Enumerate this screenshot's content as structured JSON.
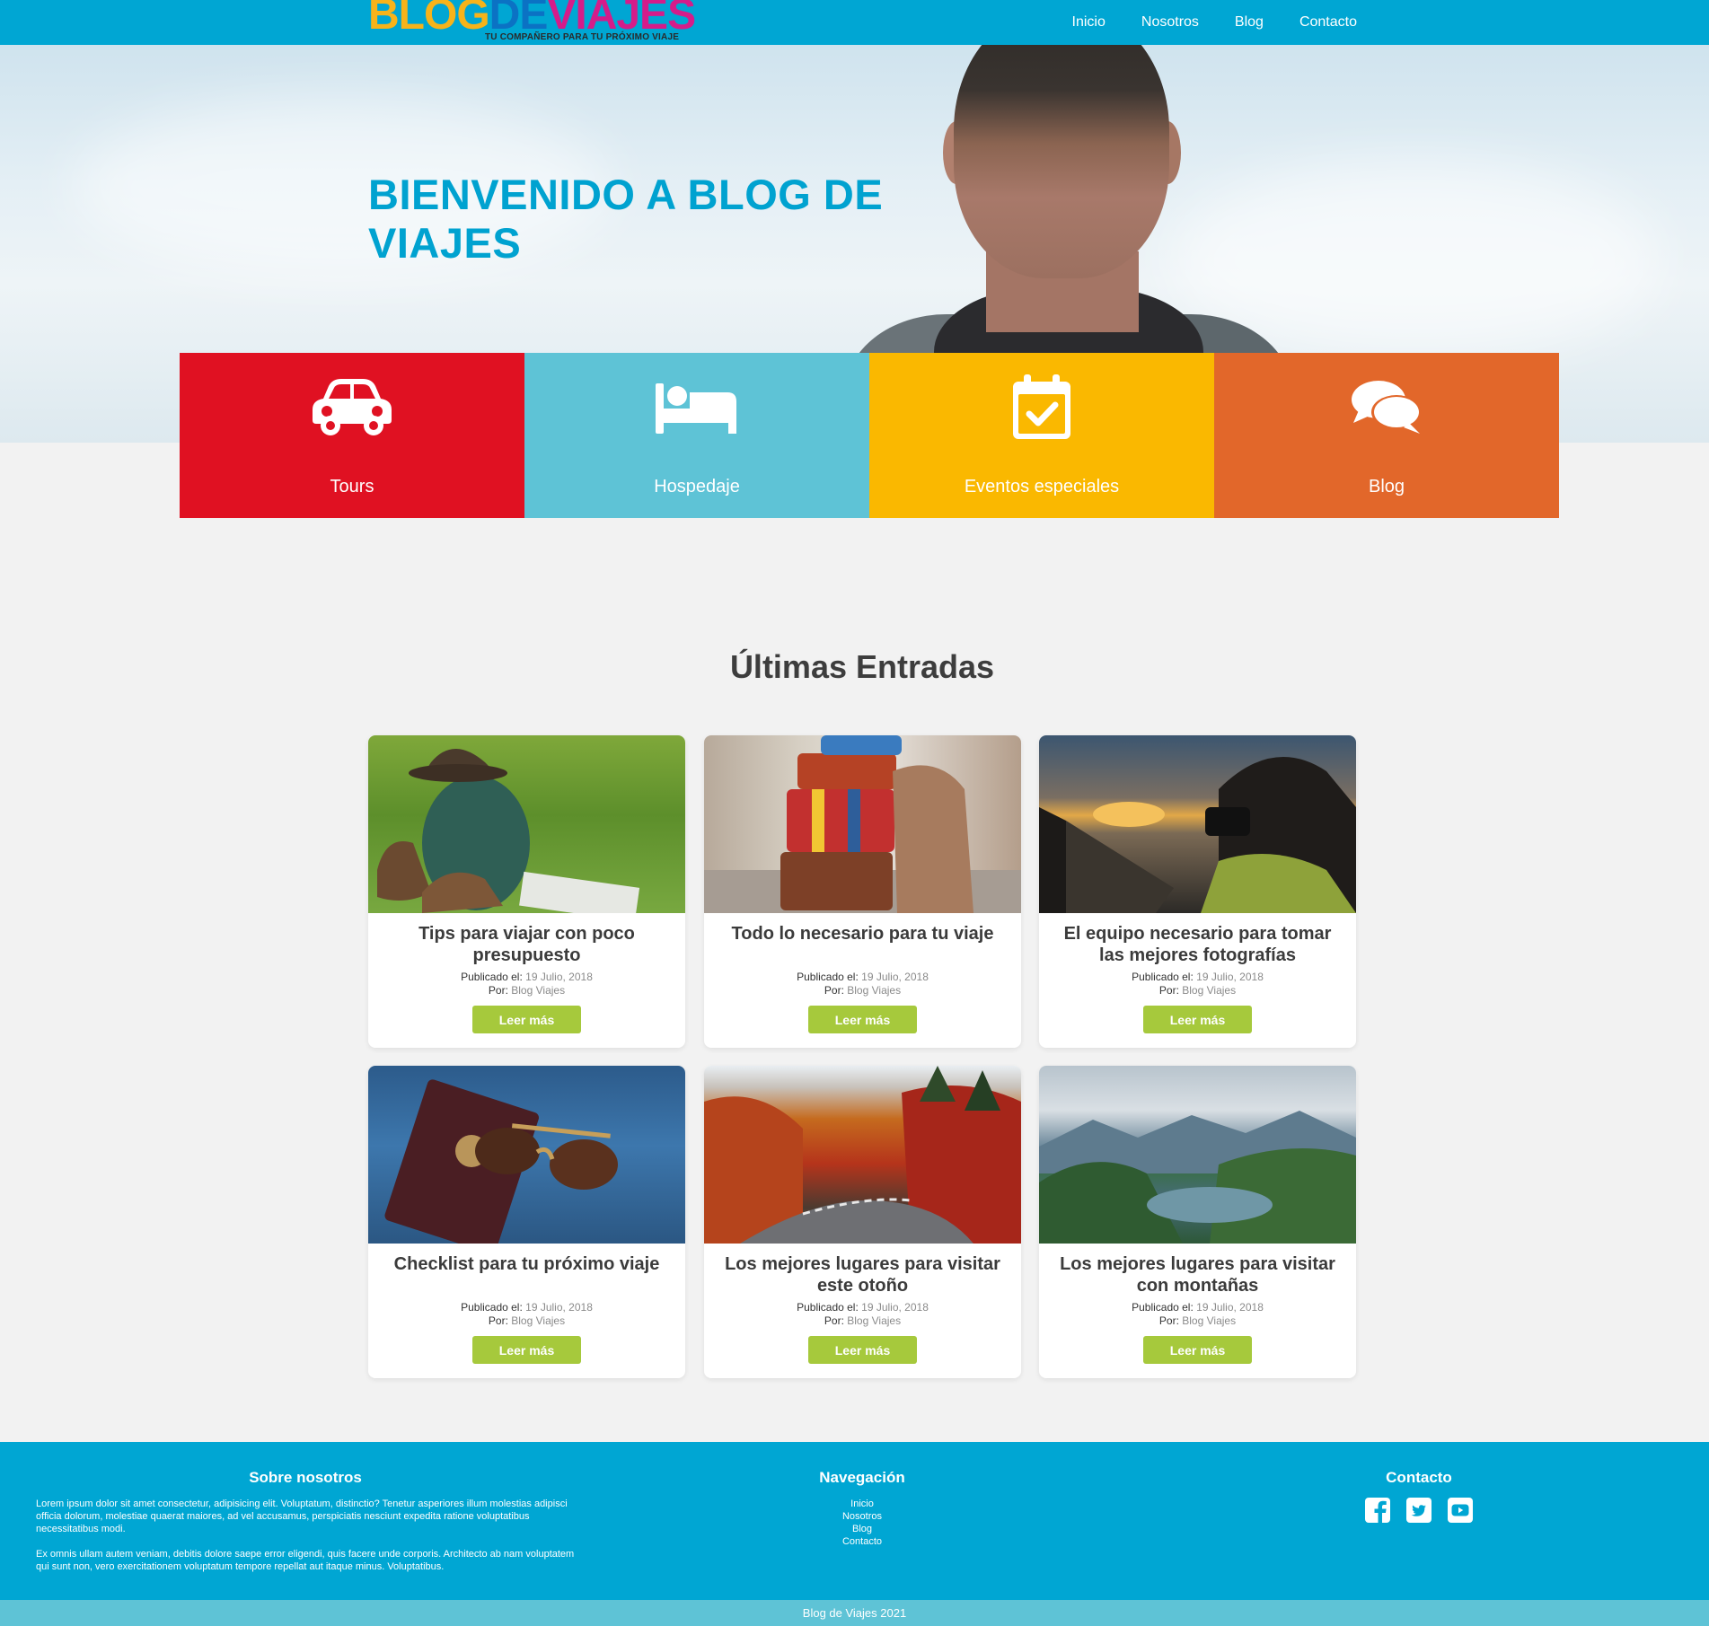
{
  "nav": {
    "logo": {
      "part1": "BLOG",
      "part2": "DE",
      "part3": "VIAJES",
      "tagline": "TU COMPAÑERO PARA TU PRÓXIMO VIAJE"
    },
    "links": [
      "Inicio",
      "Nosotros",
      "Blog",
      "Contacto"
    ]
  },
  "hero": {
    "title": "BIENVENIDO A BLOG DE VIAJES"
  },
  "services": [
    {
      "label": "Tours",
      "icon": "car-icon",
      "color": "#e01122"
    },
    {
      "label": "Hospedaje",
      "icon": "bed-icon",
      "color": "#5ec3d6"
    },
    {
      "label": "Eventos especiales",
      "icon": "calendar-check-icon",
      "color": "#fab800"
    },
    {
      "label": "Blog",
      "icon": "comments-icon",
      "color": "#e2672a"
    }
  ],
  "latest": {
    "title": "Últimas Entradas",
    "published_label": "Publicado el:",
    "by_label": "Por:",
    "button_label": "Leer más",
    "posts": [
      {
        "title": "Tips para viajar con poco presupuesto",
        "date": "19 Julio, 2018",
        "author": "Blog Viajes"
      },
      {
        "title": "Todo lo necesario para tu viaje",
        "date": "19 Julio, 2018",
        "author": "Blog Viajes"
      },
      {
        "title": "El equipo necesario para tomar las mejores fotografías",
        "date": "19 Julio, 2018",
        "author": "Blog Viajes"
      },
      {
        "title": "Checklist para tu próximo viaje",
        "date": "19 Julio, 2018",
        "author": "Blog Viajes"
      },
      {
        "title": "Los mejores lugares para visitar este otoño",
        "date": "19 Julio, 2018",
        "author": "Blog Viajes"
      },
      {
        "title": "Los mejores lugares para visitar con montañas",
        "date": "19 Julio, 2018",
        "author": "Blog Viajes"
      }
    ]
  },
  "footer": {
    "about": {
      "title": "Sobre nosotros",
      "p1": "Lorem ipsum dolor sit amet consectetur, adipisicing elit. Voluptatum, distinctio? Tenetur asperiores illum molestias adipisci officia dolorum, molestiae quaerat maiores, ad vel accusamus, perspiciatis nesciunt expedita ratione voluptatibus necessitatibus modi.",
      "p2": "Ex omnis ullam autem veniam, debitis dolore saepe error eligendi, quis facere unde corporis. Architecto ab nam voluptatem qui sunt non, vero exercitationem voluptatum tempore repellat aut itaque minus. Voluptatibus."
    },
    "navigation": {
      "title": "Navegación",
      "links": [
        "Inicio",
        "Nosotros",
        "Blog",
        "Contacto"
      ]
    },
    "contact": {
      "title": "Contacto",
      "icons": [
        "facebook-icon",
        "twitter-icon",
        "youtube-icon"
      ]
    },
    "copyright": "Blog de Viajes 2021"
  }
}
